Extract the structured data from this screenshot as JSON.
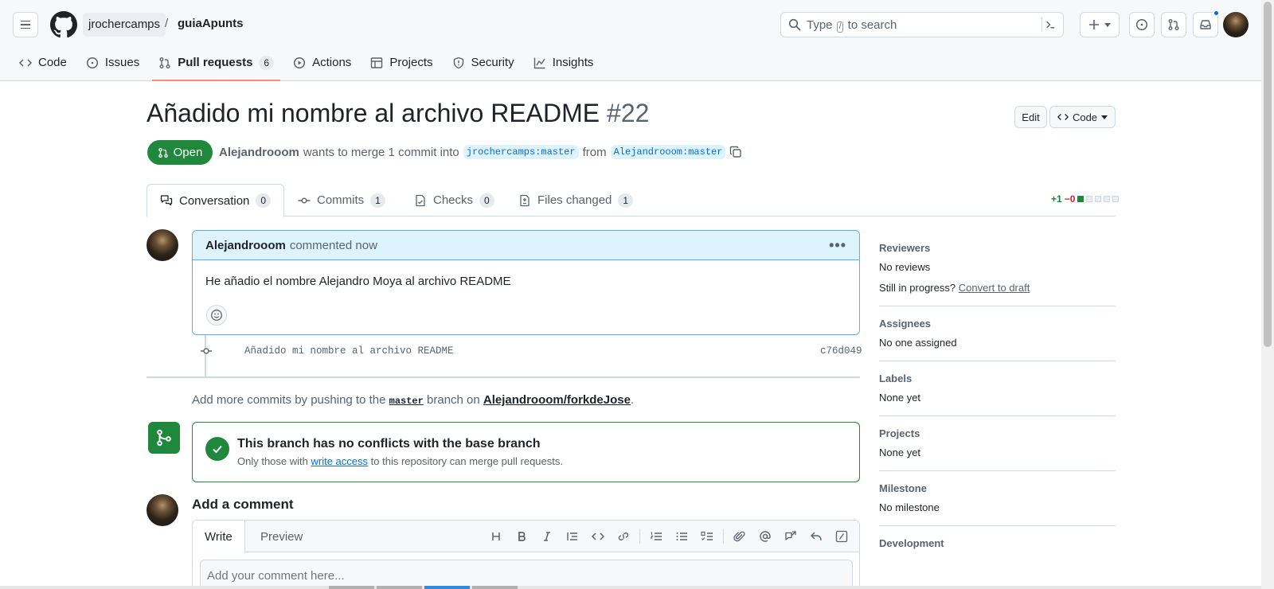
{
  "header": {
    "owner": "jrochercamps",
    "separator": "/",
    "repo": "guiaApunts",
    "search_prefix": "Type",
    "search_key": "/",
    "search_suffix": "to search"
  },
  "repo_tabs": [
    {
      "label": "Code",
      "icon": "code-icon"
    },
    {
      "label": "Issues",
      "icon": "issue-icon"
    },
    {
      "label": "Pull requests",
      "icon": "pull-request-icon",
      "count": "6",
      "active": true
    },
    {
      "label": "Actions",
      "icon": "play-icon"
    },
    {
      "label": "Projects",
      "icon": "table-icon"
    },
    {
      "label": "Security",
      "icon": "shield-icon"
    },
    {
      "label": "Insights",
      "icon": "graph-icon"
    }
  ],
  "pr": {
    "title": "Añadido mi nombre al archivo README",
    "number": "#22",
    "edit_label": "Edit",
    "code_label": "Code",
    "state": "Open",
    "author": "Alejandrooom",
    "merge_text": "wants to merge 1 commit into",
    "base_branch": "jrochercamps:master",
    "from_text": "from",
    "head_branch": "Alejandrooom:master"
  },
  "pr_tabs": [
    {
      "label": "Conversation",
      "count": "0",
      "icon": "comment-discussion-icon"
    },
    {
      "label": "Commits",
      "count": "1",
      "icon": "commit-icon"
    },
    {
      "label": "Checks",
      "count": "0",
      "icon": "checklist-icon"
    },
    {
      "label": "Files changed",
      "count": "1",
      "icon": "file-diff-icon"
    }
  ],
  "diffstat": {
    "additions": "+1",
    "deletions": "−0"
  },
  "comment": {
    "author": "Alejandrooom",
    "time": "commented now",
    "body": "He añadio el nombre Alejandro Moya al archivo README"
  },
  "commit": {
    "message": "Añadido mi nombre al archivo README",
    "sha": "c76d049"
  },
  "push_note": {
    "prefix": "Add more commits by pushing to the",
    "branch": "master",
    "middle": "branch on",
    "repo": "Alejandrooom/forkdeJose",
    "suffix": "."
  },
  "merge": {
    "heading": "This branch has no conflicts with the base branch",
    "sub_prefix": "Only those with",
    "sub_link": "write access",
    "sub_suffix": "to this repository can merge pull requests."
  },
  "add_comment": {
    "title": "Add a comment",
    "write_tab": "Write",
    "preview_tab": "Preview",
    "placeholder": "Add your comment here..."
  },
  "sidebar": {
    "reviewers_title": "Reviewers",
    "reviewers_value": "No reviews",
    "draft_prefix": "Still in progress?",
    "draft_link": "Convert to draft",
    "assignees_title": "Assignees",
    "assignees_value": "No one assigned",
    "labels_title": "Labels",
    "labels_value": "None yet",
    "projects_title": "Projects",
    "projects_value": "None yet",
    "milestone_title": "Milestone",
    "milestone_value": "No milestone",
    "development_title": "Development"
  },
  "colors": {
    "accent": "#0969da",
    "success": "#1f883d",
    "tab_underline": "#fd8c73"
  }
}
